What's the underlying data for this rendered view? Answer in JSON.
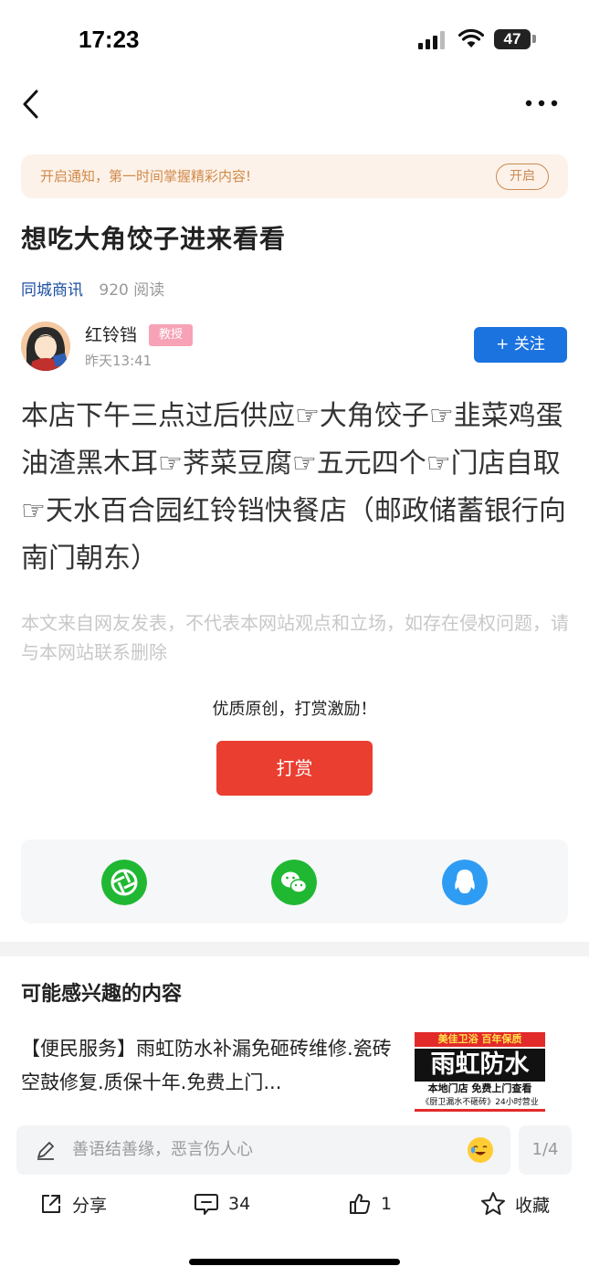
{
  "status_bar": {
    "time": "17:23",
    "battery": "47"
  },
  "notice": {
    "text": "开启通知，第一时间掌握精彩内容!",
    "button": "开启"
  },
  "article": {
    "title": "想吃大角饺子进来看看",
    "source": "同城商讯",
    "reads": "920 阅读",
    "body": "本店下午三点过后供应☞大角饺子☞韭菜鸡蛋油渣黑木耳☞荠菜豆腐☞五元四个☞门店自取☞天水百合园红铃铛快餐店（邮政储蓄银行向南门朝东）",
    "disclaimer": "本文来自网友发表，不代表本网站观点和立场，如存在侵权问题，请与本网站联系删除"
  },
  "author": {
    "name": "红铃铛",
    "badge": "教授",
    "time": "昨天13:41",
    "follow_label": "+ 关注"
  },
  "reward": {
    "prompt": "优质原创，打赏激励！",
    "button": "打赏"
  },
  "share": {
    "icons": [
      "moments-icon",
      "wechat-icon",
      "qq-icon"
    ]
  },
  "recommend": {
    "section_title": "可能感兴趣的内容",
    "items": [
      {
        "text": "【便民服务】雨虹防水补漏免砸砖维修.瓷砖空鼓修复.质保十年.免费上门...",
        "thumb_top": "美佳卫浴 百年保质",
        "thumb_main": "雨虹防水",
        "thumb_sub": "本地门店  免费上门查看",
        "thumb_foot": "《厨卫漏水不砸砖》24小时营业"
      }
    ]
  },
  "comment": {
    "placeholder": "善语结善缘，恶言伤人心",
    "page": "1/4"
  },
  "actions": {
    "share": "分享",
    "comments": "34",
    "likes": "1",
    "favorite": "收藏"
  },
  "colors": {
    "accent_blue": "#1b73e0",
    "reward_red": "#ea3e30",
    "notice_bg": "#fdf2e9"
  }
}
